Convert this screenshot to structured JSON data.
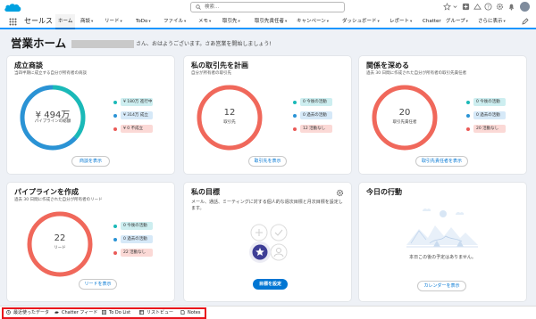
{
  "header": {
    "search_placeholder": "検索..."
  },
  "nav": {
    "app_name": "セールス",
    "items": [
      {
        "label": "ホーム"
      },
      {
        "label": "商談"
      },
      {
        "label": "リード"
      },
      {
        "label": "ToDo"
      },
      {
        "label": "ファイル"
      },
      {
        "label": "メモ"
      },
      {
        "label": "取引先"
      },
      {
        "label": "取引先責任者"
      },
      {
        "label": "キャンペーン"
      },
      {
        "label": "ダッシュボード"
      },
      {
        "label": "レポート"
      },
      {
        "label": "Chatter"
      },
      {
        "label": "グループ"
      },
      {
        "label": "さらに表示"
      }
    ]
  },
  "page": {
    "title": "営業ホーム",
    "greeting": "さん、おはようございます。さあ営業を開始しましょう!"
  },
  "cards": {
    "closed": {
      "title": "成立商談",
      "subtitle": "当四半期に成立する自分が所有者の商談",
      "value": "¥ 494万",
      "value_label": "パイプラインの総額",
      "legend": [
        "¥ 180万 進行中",
        "¥ 314万 成立",
        "¥ 0 不成立"
      ],
      "button": "商談を表示",
      "ring_colors": [
        "#1ab9b8",
        "#2a93d5"
      ]
    },
    "plan": {
      "title": "私の取引先を計画",
      "subtitle": "自分が所有者の取引先",
      "value": "12",
      "value_label": "取引先",
      "legend": [
        "0 今後の活動",
        "0 過去の活動",
        "12 活動なし"
      ],
      "button": "取引先を表示",
      "ring_color": "#f0685b"
    },
    "deepen": {
      "title": "関係を深める",
      "subtitle": "過去 30 日間に作成された自分が所有者の取引先責任者",
      "value": "20",
      "value_label": "取引先責任者",
      "legend": [
        "0 今後の活動",
        "0 過去の活動",
        "20 活動なし"
      ],
      "button": "取引先責任者を表示",
      "ring_color": "#f0685b"
    },
    "pipeline": {
      "title": "パイプラインを作成",
      "subtitle": "過去 30 日間に作成された自分が所有者のリード",
      "value": "22",
      "value_label": "リード",
      "legend": [
        "0 今後の活動",
        "0 過去の活動",
        "22 活動なし"
      ],
      "button": "リードを表示",
      "ring_color": "#f0685b"
    },
    "goals": {
      "title": "私の目標",
      "description": "メール、通話、ミーティングに対する個人的な週次目標と月次目標を設定します。",
      "button": "目標を設定"
    },
    "today": {
      "title": "今日の行動",
      "empty_text": "本日この後の予定はありません。",
      "button": "カレンダーを表示"
    }
  },
  "colors": {
    "upcoming": "#1ab9b8",
    "past": "#2a93d5",
    "none": "#ea5a57",
    "accent": "#0176d3"
  },
  "utility": {
    "items": [
      {
        "label": "最近使ったデータ",
        "icon": "history-icon"
      },
      {
        "label": "Chatter フィード",
        "icon": "chatter-icon"
      },
      {
        "label": "To Do List",
        "icon": "todo-list-icon"
      },
      {
        "label": "リストビュー",
        "icon": "list-view-icon"
      },
      {
        "label": "Notes",
        "icon": "notes-icon"
      }
    ]
  }
}
